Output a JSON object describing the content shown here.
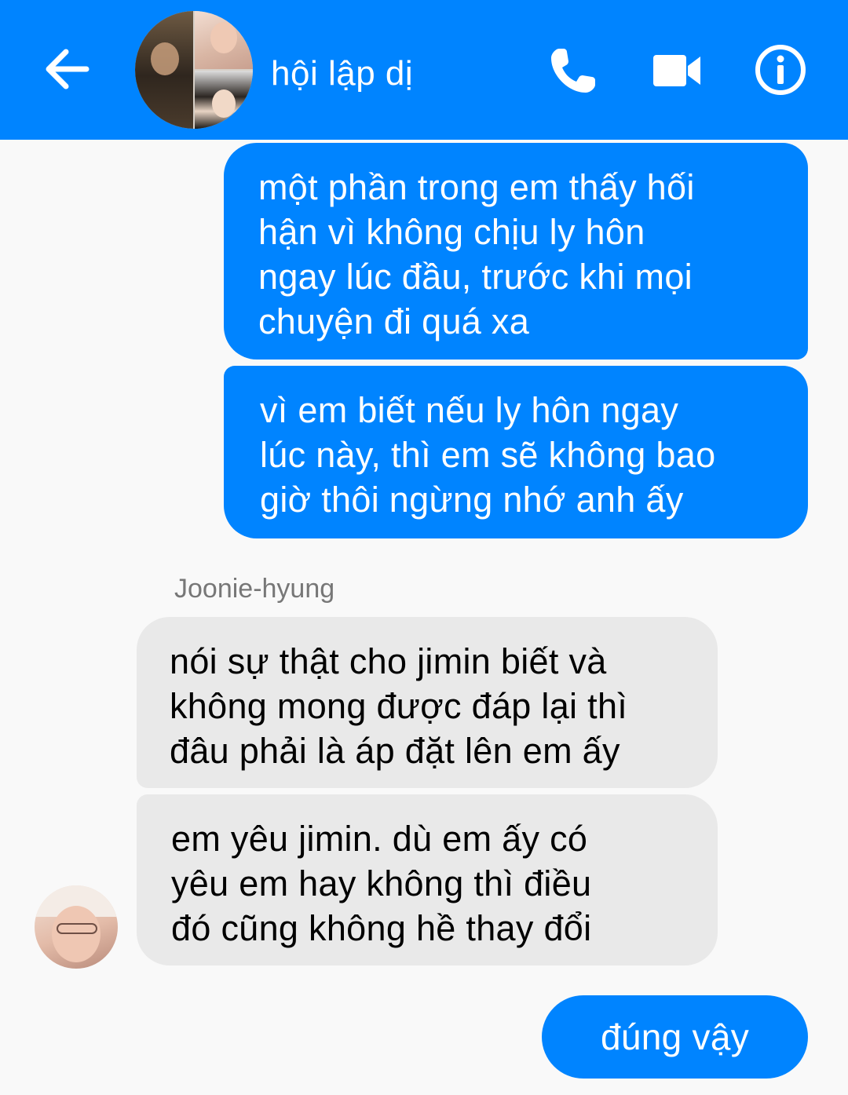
{
  "header": {
    "title": "hội lập dị",
    "bg_color": "#0084ff",
    "icons": [
      "arrow-left-icon",
      "phone-icon",
      "video-camera-icon",
      "info-icon"
    ]
  },
  "messages": [
    {
      "direction": "outgoing",
      "lines": [
        "một phần trong em thấy hối",
        "hận vì không chịu ly hôn",
        "ngay lúc đầu, trước khi mọi",
        "chuyện đi quá xa"
      ]
    },
    {
      "direction": "outgoing",
      "lines": [
        "vì em biết nếu ly hôn ngay",
        "lúc này, thì em sẽ không bao",
        "giờ thôi ngừng nhớ anh ấy"
      ]
    },
    {
      "direction": "incoming",
      "sender": "Joonie-hyung",
      "lines": [
        "nói sự thật cho jimin biết và",
        "không mong được đáp lại thì",
        "đâu phải là áp đặt lên em ấy"
      ]
    },
    {
      "direction": "incoming",
      "lines": [
        "em yêu jimin. dù em ấy có",
        "yêu em hay không thì điều",
        "đó cũng không hề thay đổi"
      ]
    },
    {
      "direction": "outgoing",
      "lines": [
        "đúng vậy"
      ]
    }
  ],
  "colors": {
    "outgoing_bubble": "#0084ff",
    "incoming_bubble": "#e9e9e9",
    "background": "#f9f9f9"
  }
}
